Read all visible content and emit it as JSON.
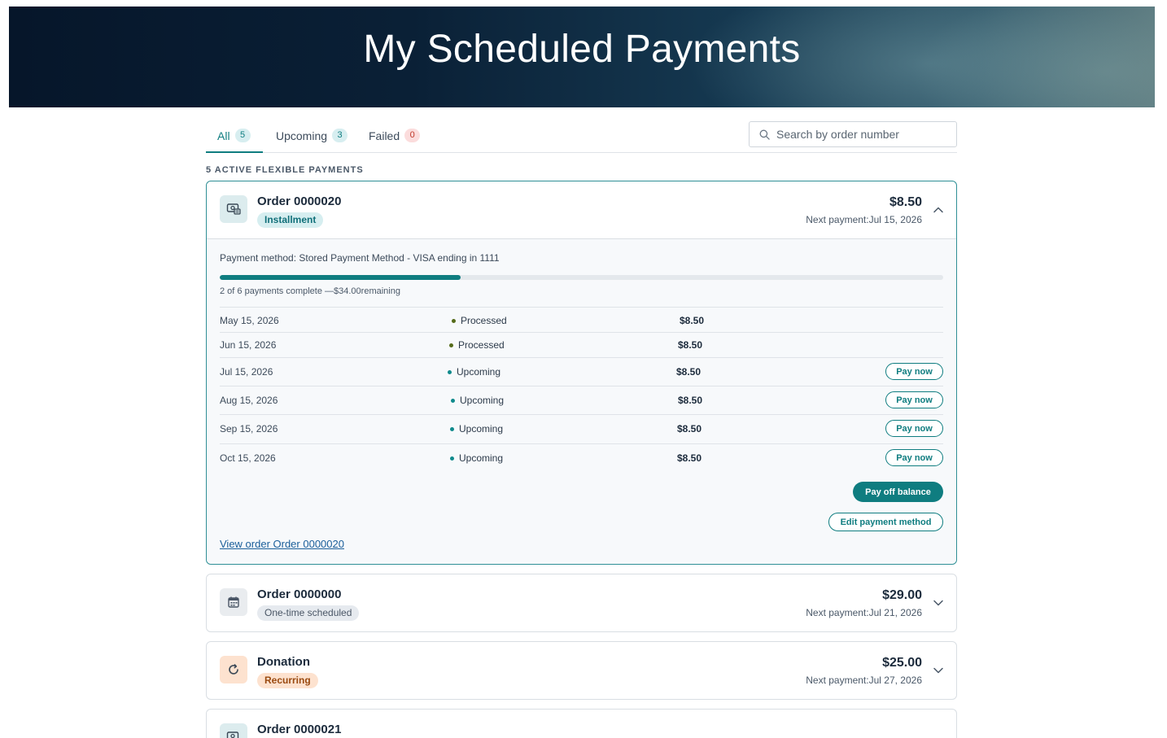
{
  "header": {
    "title": "My Scheduled Payments"
  },
  "tabs": [
    {
      "label": "All",
      "count": "5"
    },
    {
      "label": "Upcoming",
      "count": "3"
    },
    {
      "label": "Failed",
      "count": "0"
    }
  ],
  "search": {
    "placeholder": "Search by order number",
    "value": ""
  },
  "section_label": "5 ACTIVE FLEXIBLE PAYMENTS",
  "cards": [
    {
      "title": "Order 0000020",
      "tag": "Installment",
      "amount": "$8.50",
      "next_payment": "Next payment:Jul 15, 2026",
      "payment_method": "Payment method: Stored Payment Method - VISA ending in 1111",
      "progress_fraction": 0.333,
      "progress_text": "2 of 6 payments complete —$34.00remaining",
      "schedule": [
        {
          "date": "May 15, 2026",
          "status": "Processed",
          "amount": "$8.50"
        },
        {
          "date": "Jun 15, 2026",
          "status": "Processed",
          "amount": "$8.50"
        },
        {
          "date": "Jul 15, 2026",
          "status": "Upcoming",
          "amount": "$8.50",
          "action": "Pay now"
        },
        {
          "date": "Aug 15, 2026",
          "status": "Upcoming",
          "amount": "$8.50",
          "action": "Pay now"
        },
        {
          "date": "Sep 15, 2026",
          "status": "Upcoming",
          "amount": "$8.50",
          "action": "Pay now"
        },
        {
          "date": "Oct 15, 2026",
          "status": "Upcoming",
          "amount": "$8.50",
          "action": "Pay now"
        }
      ],
      "pay_off_label": "Pay off balance",
      "edit_method_label": "Edit payment method",
      "view_order_link": "View order Order 0000020"
    },
    {
      "title": "Order 0000000",
      "tag": "One-time scheduled",
      "amount": "$29.00",
      "next_payment": "Next payment:Jul 21, 2026"
    },
    {
      "title": "Donation",
      "tag": "Recurring",
      "amount": "$25.00",
      "next_payment": "Next payment:Jul 27, 2026"
    },
    {
      "title": "Order 0000021"
    }
  ],
  "colors": {
    "accent": "#0f7d80",
    "link": "#1a5e9a",
    "failed": "#c0392b"
  },
  "icons": {
    "installment": "money-card-icon",
    "onetime": "calendar-icon",
    "recurring": "refresh-icon",
    "search": "search-icon"
  }
}
